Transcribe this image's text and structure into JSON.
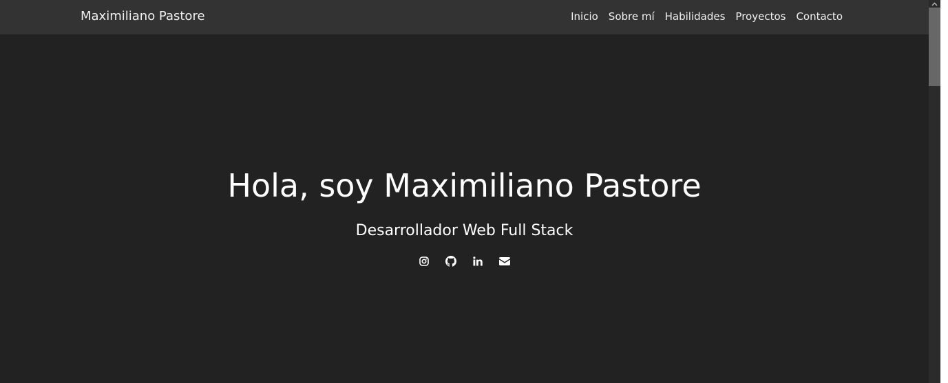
{
  "navbar": {
    "brand": "Maximiliano Pastore",
    "links": [
      {
        "label": "Inicio"
      },
      {
        "label": "Sobre mí"
      },
      {
        "label": "Habilidades"
      },
      {
        "label": "Proyectos"
      },
      {
        "label": "Contacto"
      }
    ]
  },
  "hero": {
    "title": "Hola, soy Maximiliano Pastore",
    "subtitle": "Desarrollador Web Full Stack",
    "social_icons": [
      "instagram-icon",
      "github-icon",
      "linkedin-icon",
      "envelope-icon"
    ]
  },
  "colors": {
    "background": "#222222",
    "navbar": "#333333",
    "text": "#ffffff",
    "scrollbar_track": "#2b2b2b",
    "scrollbar_thumb": "#676767"
  }
}
